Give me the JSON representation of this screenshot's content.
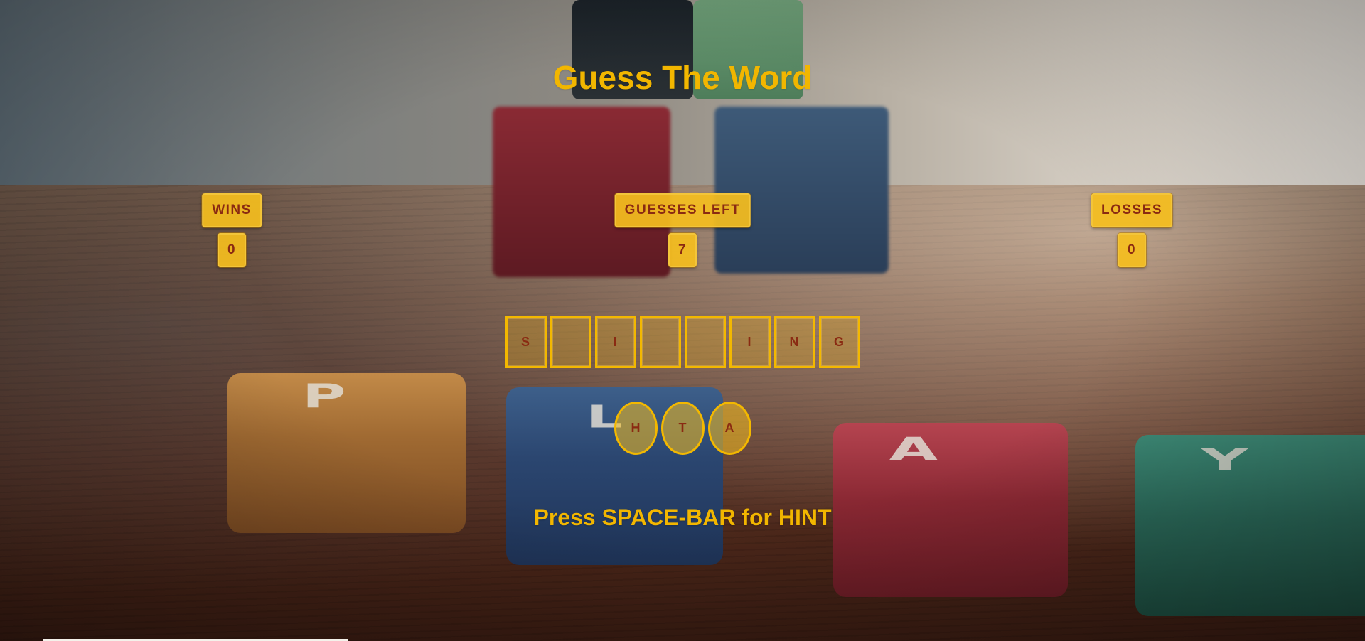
{
  "title": "Guess The Word",
  "stats": {
    "wins_label": "WINS",
    "wins_value": "0",
    "guesses_label": "GUESSES LEFT",
    "guesses_value": "7",
    "losses_label": "LOSSES",
    "losses_value": "0"
  },
  "word_tiles": [
    "S",
    "",
    "I",
    "",
    "",
    "I",
    "N",
    "G"
  ],
  "guessed_letters": [
    "H",
    "T",
    "A"
  ],
  "hint": "Press SPACE-BAR for HINT",
  "background": {
    "block_letters": [
      "P",
      "L",
      "A",
      "Y"
    ]
  },
  "colors": {
    "accent": "#f2b600",
    "tile_text": "#8a2a12"
  }
}
